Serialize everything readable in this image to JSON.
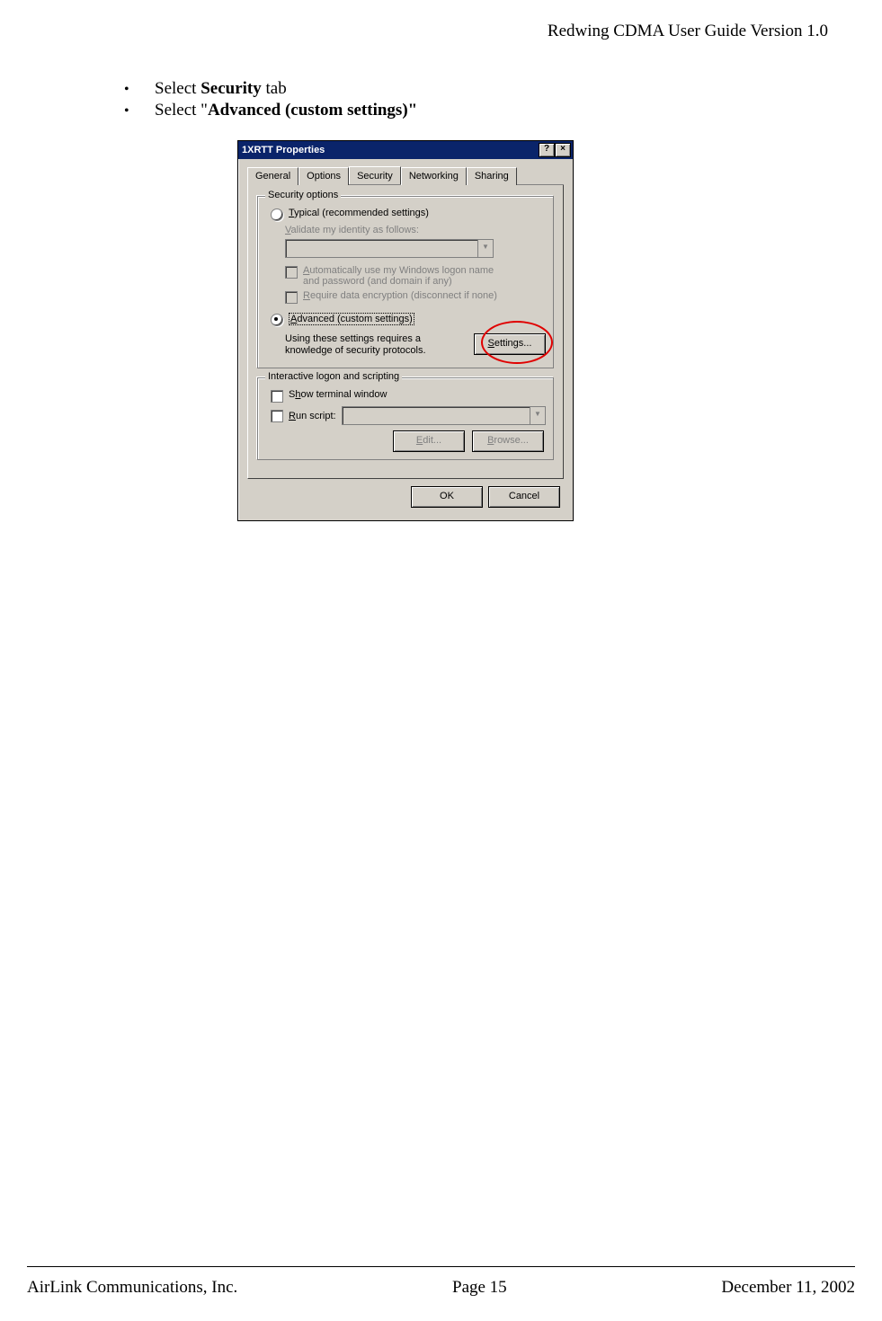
{
  "header": {
    "title": "Redwing CDMA User Guide Version 1.0"
  },
  "bullets": [
    {
      "pre": "Select ",
      "bold": "Security",
      "post": " tab"
    },
    {
      "pre": "Select \"",
      "bold": "Advanced (custom settings)\"",
      "post": ""
    }
  ],
  "dialog": {
    "title": "1XRTT Properties",
    "help_glyph": "?",
    "close_glyph": "×",
    "tabs": [
      "General",
      "Options",
      "Security",
      "Networking",
      "Sharing"
    ],
    "active_tab": "Security",
    "group1": {
      "legend": "Security options",
      "typical": {
        "hotkey": "T",
        "rest": "ypical (recommended settings)"
      },
      "validate_label": {
        "hotkey": "V",
        "rest": "alidate my identity as follows:"
      },
      "auto_logon": {
        "hotkey": "A",
        "rest": "utomatically use my Windows logon name and password (and domain if any)"
      },
      "require_enc": {
        "hotkey": "R",
        "rest": "equire data encryption (disconnect if none)"
      },
      "advanced": {
        "hotkey": "A",
        "rest": "dvanced (custom settings)"
      },
      "advanced_desc": "Using these settings requires a knowledge of security protocols.",
      "settings_btn": {
        "hotkey": "S",
        "rest": "ettings..."
      }
    },
    "group2": {
      "legend": "Interactive logon and scripting",
      "terminal": {
        "hotkey": "h",
        "pre": "S",
        "rest": "ow terminal window"
      },
      "runscript": {
        "hotkey": "R",
        "rest": "un script:"
      },
      "edit_btn": {
        "hotkey": "E",
        "rest": "dit..."
      },
      "browse_btn": {
        "hotkey": "B",
        "rest": "rowse..."
      }
    },
    "ok": "OK",
    "cancel": "Cancel"
  },
  "footer": {
    "left": "AirLink Communications, Inc.",
    "center": "Page 15",
    "right": "December 11, 2002"
  }
}
